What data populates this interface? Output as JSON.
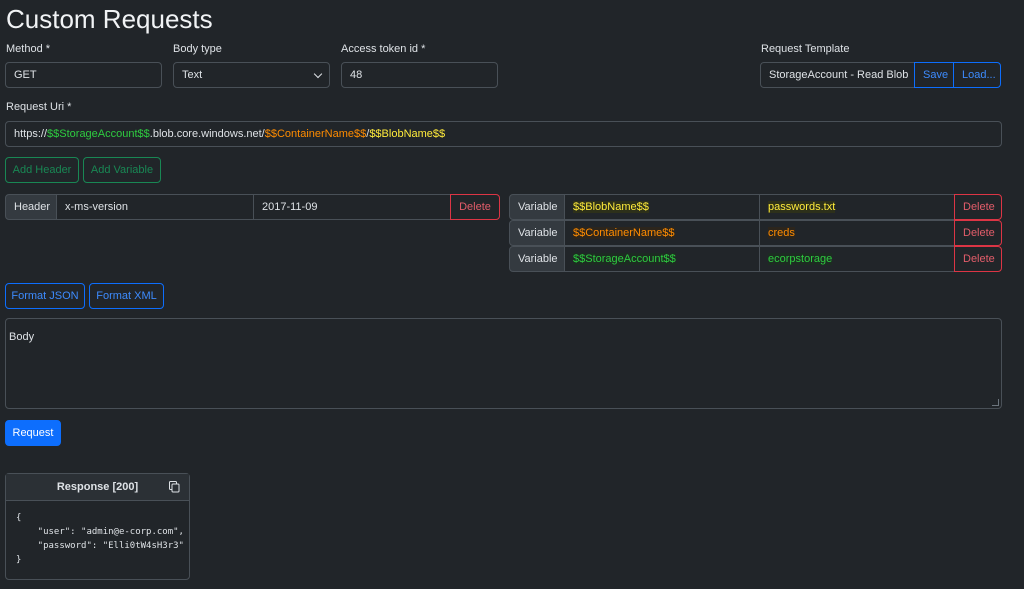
{
  "page": {
    "title": "Custom Requests"
  },
  "form": {
    "method_label": "Method *",
    "method_value": "GET",
    "body_type_label": "Body type",
    "body_type_value": "Text",
    "token_label": "Access token id *",
    "token_value": "48",
    "template_label": "Request Template",
    "template_value": "StorageAccount - Read Blob",
    "save_label": "Save",
    "load_label": "Load...",
    "uri_label": "Request Uri *",
    "uri_parts": [
      "https://",
      "$$StorageAccount$$",
      ".blob.core.windows.net/",
      "$$ContainerName$$",
      "/",
      "$$BlobName$$"
    ]
  },
  "actions": {
    "add_header": "Add Header",
    "add_variable": "Add Variable",
    "format_json": "Format JSON",
    "format_xml": "Format XML",
    "request": "Request"
  },
  "headers": [
    {
      "addon": "Header",
      "name": "x-ms-version",
      "value": "2017-11-09",
      "delete": "Delete"
    }
  ],
  "variables": [
    {
      "addon": "Variable",
      "name": "$$BlobName$$",
      "value": "passwords.txt",
      "delete": "Delete"
    },
    {
      "addon": "Variable",
      "name": "$$ContainerName$$",
      "value": "creds",
      "delete": "Delete"
    },
    {
      "addon": "Variable",
      "name": "$$StorageAccount$$",
      "value": "ecorpstorage",
      "delete": "Delete"
    }
  ],
  "body": {
    "placeholder": "Body"
  },
  "response": {
    "title": "Response [200]",
    "lines": [
      "{",
      "    \"user\": \"admin@e-corp.com\",",
      "    \"password\": \"Elli0tW4sH3r3\"",
      "}"
    ]
  },
  "colors": {
    "storage_account": "#2ecc40",
    "container_name": "#ff8c00",
    "blob_name": "#ffeb3b",
    "primary": "#0d6efd",
    "danger": "#dc3545",
    "success": "#198754"
  },
  "icons": {
    "copy": "copy-icon",
    "select_chevron": "chevron-down-icon"
  }
}
